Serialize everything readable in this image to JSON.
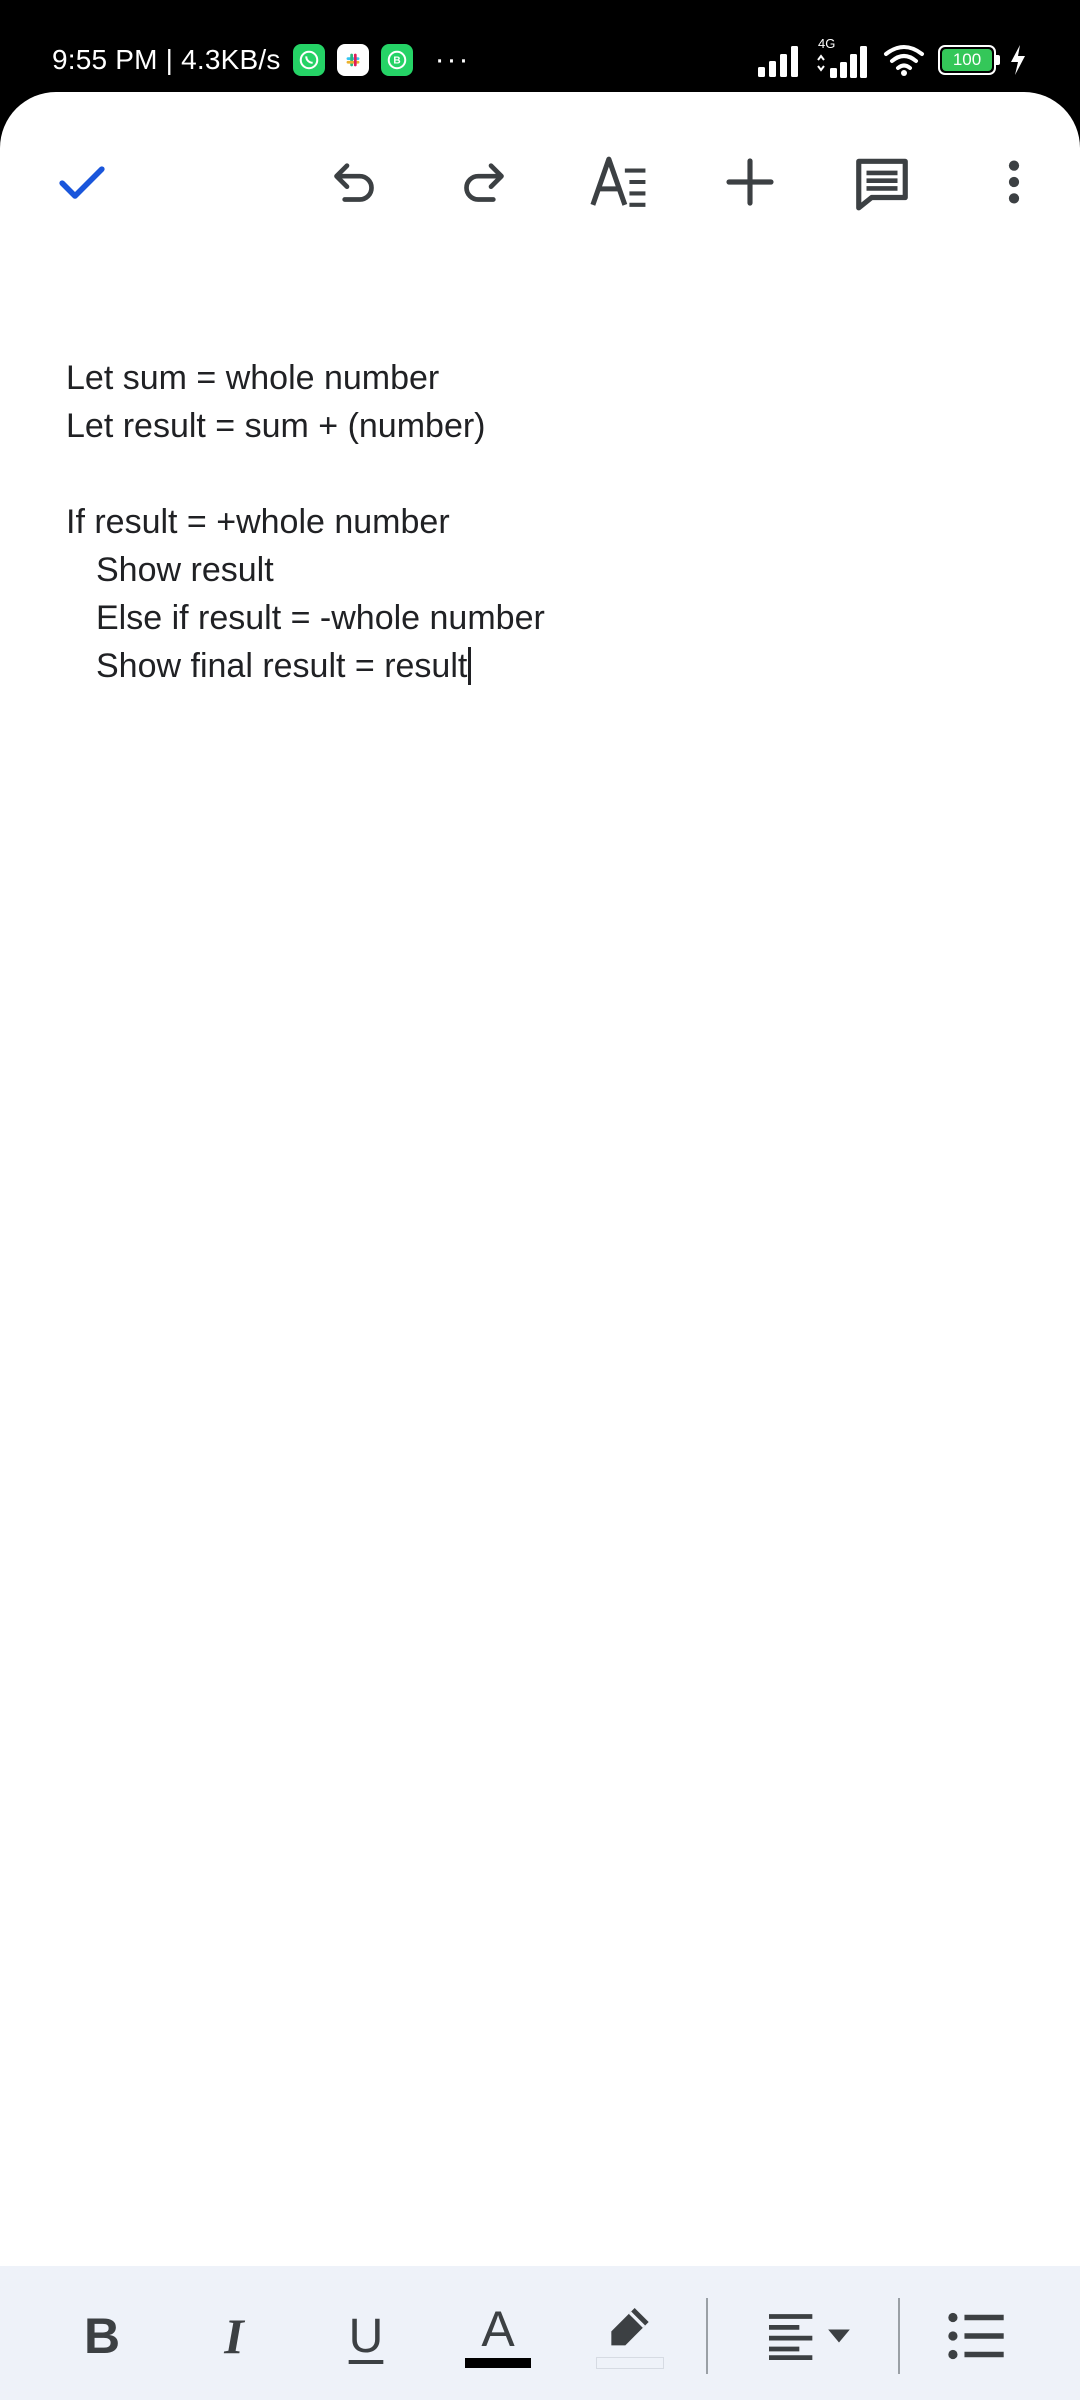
{
  "status_bar": {
    "time_speed": "9:55 PM | 4.3KB/s",
    "overflow": "···",
    "network_label": "4G",
    "battery": "100"
  },
  "toolbar": {
    "icons": [
      "check-icon",
      "undo-icon",
      "redo-icon",
      "text-format-icon",
      "insert-plus-icon",
      "comment-icon",
      "more-vert-icon"
    ]
  },
  "document": {
    "lines": [
      "Let sum = whole number",
      "Let result = sum + (number)",
      "",
      "If result = +whole number",
      "Show result",
      "Else if result = -whole number",
      "Show final result = result"
    ]
  },
  "format_bar": {
    "bold_label": "B",
    "italic_label": "I",
    "underline_label": "U",
    "text_color_label": "A",
    "text_color": "#000000",
    "accent_color": "#1a56db"
  }
}
